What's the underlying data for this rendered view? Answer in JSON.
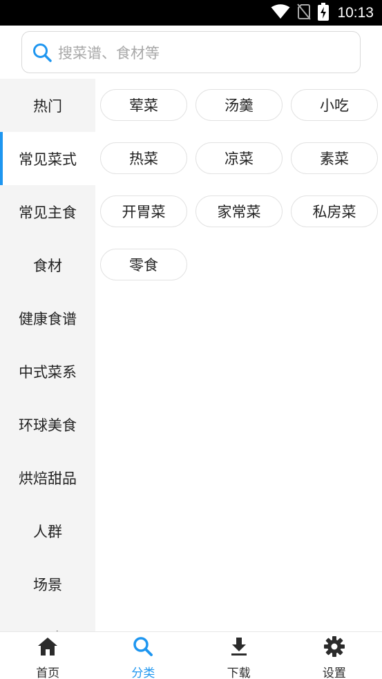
{
  "status_bar": {
    "time": "10:13",
    "icons": [
      "wifi-icon",
      "no-sim-icon",
      "battery-charging-icon"
    ]
  },
  "search": {
    "placeholder": "搜菜谱、食材等",
    "icon": "search-icon"
  },
  "sidebar": {
    "active_index": 1,
    "items": [
      {
        "label": "热门"
      },
      {
        "label": "常见菜式"
      },
      {
        "label": "常见主食"
      },
      {
        "label": "食材"
      },
      {
        "label": "健康食谱"
      },
      {
        "label": "中式菜系"
      },
      {
        "label": "环球美食"
      },
      {
        "label": "烘焙甜品"
      },
      {
        "label": "人群"
      },
      {
        "label": "场景"
      },
      {
        "label": "口味"
      }
    ]
  },
  "tags": [
    {
      "label": "荤菜"
    },
    {
      "label": "汤羹"
    },
    {
      "label": "小吃"
    },
    {
      "label": "热菜"
    },
    {
      "label": "凉菜"
    },
    {
      "label": "素菜"
    },
    {
      "label": "开胃菜"
    },
    {
      "label": "家常菜"
    },
    {
      "label": "私房菜"
    },
    {
      "label": "零食"
    }
  ],
  "bottom_nav": {
    "active_index": 1,
    "items": [
      {
        "label": "首页",
        "icon": "home-icon"
      },
      {
        "label": "分类",
        "icon": "search-icon"
      },
      {
        "label": "下载",
        "icon": "download-icon"
      },
      {
        "label": "设置",
        "icon": "gear-icon"
      }
    ]
  },
  "colors": {
    "accent": "#1e96f0",
    "sidebar_bg": "#f4f4f4",
    "status_bar_bg": "#000000"
  }
}
